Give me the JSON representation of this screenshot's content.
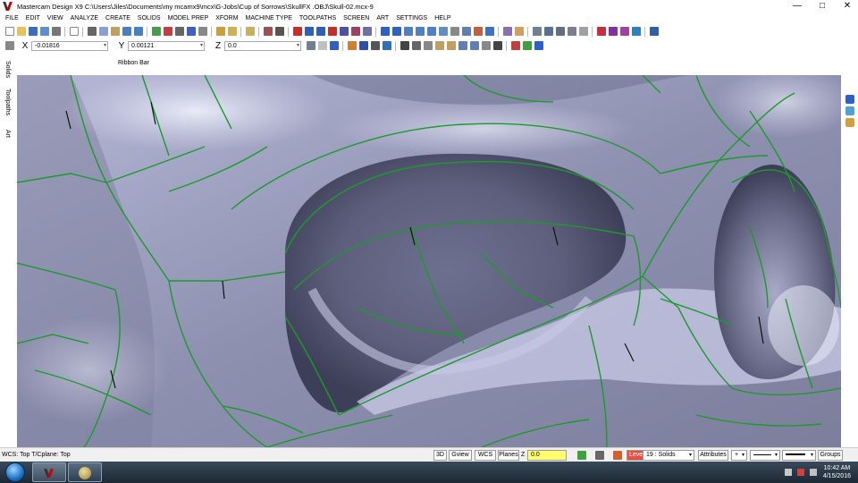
{
  "window": {
    "title": "Mastercam Design X9  C:\\Users\\Jiles\\Documents\\my mcamx9\\mcx\\G-Jobs\\Cup of Sorrows\\SkullFX .OBJ\\Skull-02.mcx-9",
    "minimize": "—",
    "maximize": "□",
    "close": "✕"
  },
  "menu": [
    "FILE",
    "EDIT",
    "VIEW",
    "ANALYZE",
    "CREATE",
    "SOLIDS",
    "MODEL PREP",
    "XFORM",
    "MACHINE TYPE",
    "TOOLPATHS",
    "SCREEN",
    "ART",
    "SETTINGS",
    "HELP"
  ],
  "coordinates": {
    "x_label": "X",
    "x_value": "-0.01816",
    "y_label": "Y",
    "y_value": "0.00121",
    "z_label": "Z",
    "z_value": "0.0"
  },
  "ribbon_bar_label": "Ribbon Bar",
  "manager_tabs": [
    "Solids",
    "Toolpaths",
    "Art"
  ],
  "status": {
    "wcs": "WCS: Top  T/Cplane: Top",
    "btn_3d": "3D",
    "btn_gview": "Gview",
    "btn_wcs": "WCS",
    "btn_planes": "Planes",
    "z_label": "Z",
    "z_value": "0.0",
    "level_label": "Level",
    "level_value": "19 : Solids",
    "attributes": "Attributes",
    "groups": "Groups"
  },
  "taskbar": {
    "time": "10:42 AM",
    "date": "4/15/2016"
  },
  "colors": {
    "accent_menu": "#1f4e8c",
    "wireframe_edges": "#22aa33",
    "surface": "#9b9dbf",
    "level_button": "#e85040",
    "z_field": "#ffff70"
  }
}
